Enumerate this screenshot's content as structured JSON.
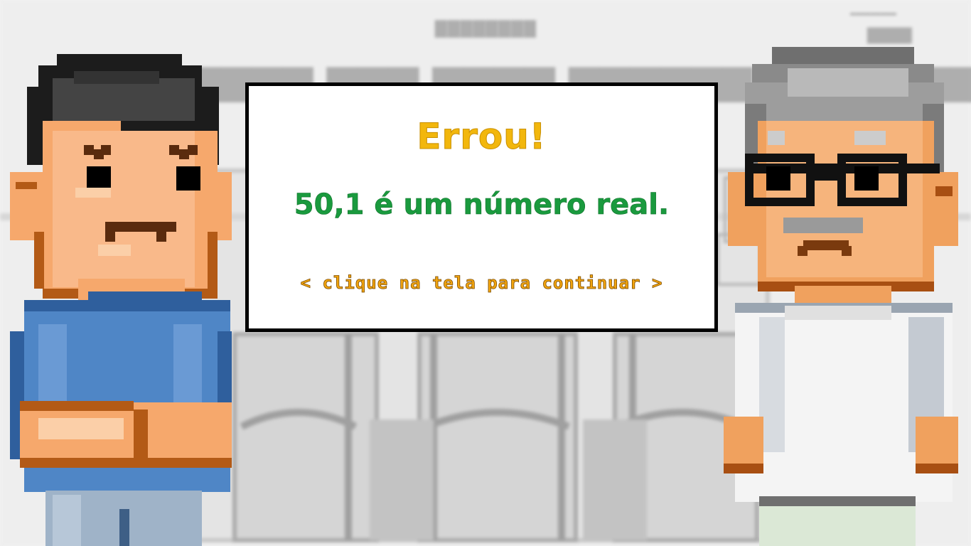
{
  "dialog": {
    "title": "Errou!",
    "message": "50,1 é um número real.",
    "hint": "< clique na tela para continuar >"
  },
  "colors": {
    "title": "#f2b70d",
    "message": "#1a9a3e",
    "hint": "#f2a50f",
    "dialog_border": "#000000",
    "dialog_background": "#ffffff",
    "left_character_shirt": "#4f86c6",
    "right_character_shirt": "#f4f4f4"
  }
}
